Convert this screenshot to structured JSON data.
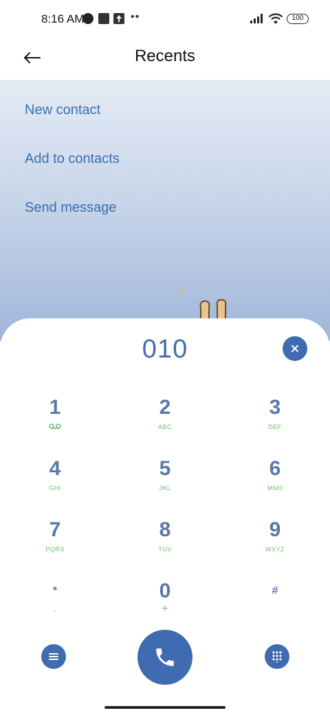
{
  "status": {
    "time": "8:16 AM",
    "battery": "100"
  },
  "app_bar": {
    "title": "Recents"
  },
  "menu": {
    "items": [
      {
        "label": "New contact"
      },
      {
        "label": "Add to contacts"
      },
      {
        "label": "Send message"
      }
    ]
  },
  "dialer": {
    "number": "010",
    "keys": [
      {
        "digit": "1",
        "letters": ""
      },
      {
        "digit": "2",
        "letters": "ABC"
      },
      {
        "digit": "3",
        "letters": "DEF"
      },
      {
        "digit": "4",
        "letters": "GHI"
      },
      {
        "digit": "5",
        "letters": "JKL"
      },
      {
        "digit": "6",
        "letters": "MNO"
      },
      {
        "digit": "7",
        "letters": "PQRS"
      },
      {
        "digit": "8",
        "letters": "TUV"
      },
      {
        "digit": "9",
        "letters": "WXYZ"
      },
      {
        "digit": "*",
        "letters": ","
      },
      {
        "digit": "0",
        "letters": "+"
      },
      {
        "digit": "#",
        "letters": ""
      }
    ]
  },
  "icons": {
    "back": "arrow-left-icon",
    "clear": "close-icon",
    "voicemail": "voicemail-icon",
    "menu": "menu-icon",
    "call": "phone-icon",
    "keypad": "dialpad-icon"
  },
  "colors": {
    "accent": "#3f6bb0",
    "digit": "#5a78a8",
    "letters": "#6bbf6b",
    "link": "#3a6fb0"
  }
}
